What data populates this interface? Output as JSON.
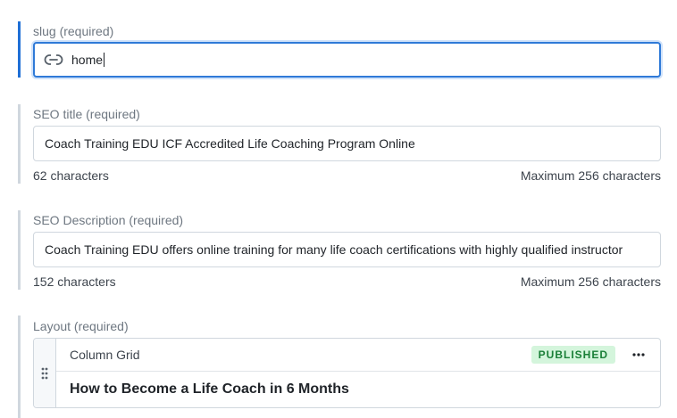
{
  "slug": {
    "label": "slug (required)",
    "value": "home",
    "icon": "link-icon"
  },
  "seo_title": {
    "label": "SEO title (required)",
    "value": "Coach Training EDU ICF Accredited Life Coaching Program Online",
    "count": "62 characters",
    "max": "Maximum 256 characters"
  },
  "seo_description": {
    "label": "SEO Description (required)",
    "value": "Coach Training EDU offers online training for many life coach certifications with highly qualified instructor",
    "count": "152 characters",
    "max": "Maximum 256 characters"
  },
  "layout": {
    "label": "Layout (required)",
    "block": {
      "type": "Column Grid",
      "status": "PUBLISHED",
      "title": "How to Become a Life Coach in 6 Months"
    }
  },
  "colors": {
    "focus_border": "#2f7ad8",
    "active_bar": "#1f6fd6",
    "badge_bg": "#d4f5dc",
    "badge_text": "#1a7f37"
  }
}
